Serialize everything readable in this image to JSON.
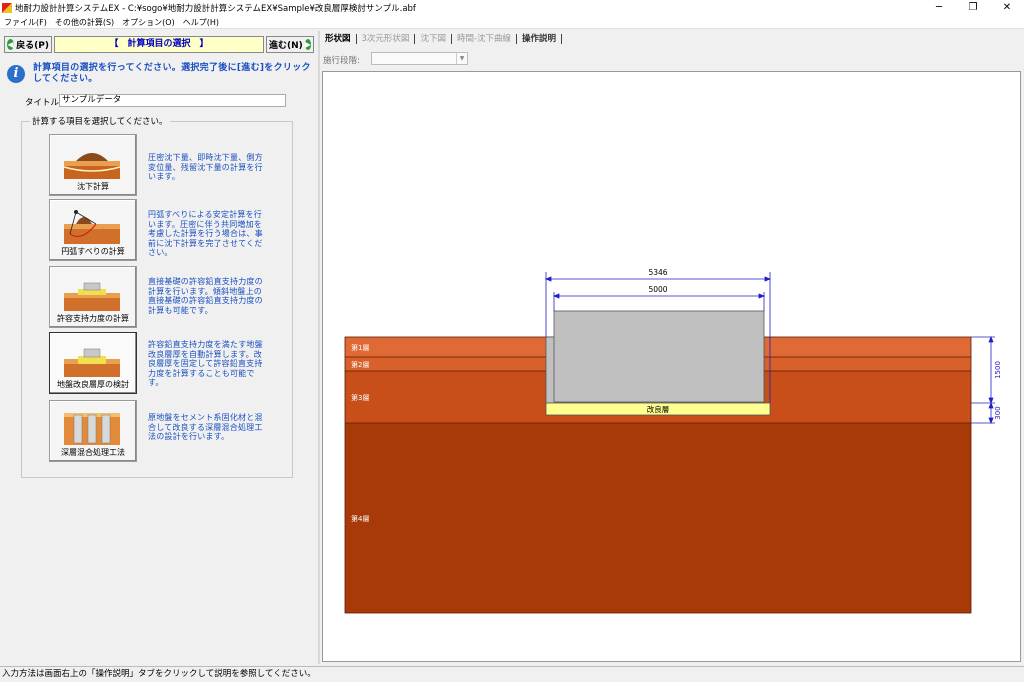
{
  "window": {
    "title": "地耐力設計計算システムEX - C:¥sogo¥地耐力設計計算システムEX¥Sample¥改良層厚検討サンプル.abf",
    "minimize": "─",
    "maximize": "❐",
    "close": "✕"
  },
  "menu": [
    "ファイル(F)",
    "その他の計算(S)",
    "オプション(O)",
    "ヘルプ(H)"
  ],
  "left": {
    "back_label": "戻る(P)",
    "step_title": "【　計算項目の選択　】",
    "next_label": "進む(N)",
    "instruction": "計算項目の選択を行ってください。選択完了後に[進む]をクリックしてください。",
    "title_label": "タイトル:",
    "title_value": "サンプルデータ",
    "group_label": "計算する項目を選択してください。",
    "items": [
      {
        "label": "沈下計算",
        "desc": "圧密沈下量、即時沈下量、側方変位量、残留沈下量の計算を行います。"
      },
      {
        "label": "円弧すべりの計算",
        "desc": "円弧すべりによる安定計算を行います。圧密に伴う共同増加を考慮した計算を行う場合は、事前に沈下計算を完了させてください。"
      },
      {
        "label": "許容支持力度の計算",
        "desc": "直接基礎の許容鉛直支持力度の計算を行います。傾斜地盤上の直接基礎の許容鉛直支持力度の計算も可能です。"
      },
      {
        "label": "地盤改良層厚の検討",
        "desc": "許容鉛直支持力度を満たす地盤改良層厚を自動計算します。改良層厚を固定して許容鉛直支持力度を計算することも可能です。"
      },
      {
        "label": "深層混合処理工法",
        "desc": "原地盤をセメント系固化材と混合して改良する深層混合処理工法の設計を行います。"
      }
    ]
  },
  "right": {
    "tabs": [
      "形状図",
      "3次元形状図",
      "沈下図",
      "時間-沈下曲線",
      "操作説明"
    ],
    "phase_label": "施行段階:",
    "drawing": {
      "dim_top": "5346",
      "dim_inner": "5000",
      "dim_right_upper": "1500",
      "dim_right_lower": "300",
      "improved_label": "改良層",
      "layers": [
        {
          "name": "第1層",
          "color": "#e06a35"
        },
        {
          "name": "第2層",
          "color": "#d8602a"
        },
        {
          "name": "第3層",
          "color": "#c84e1a"
        },
        {
          "name": "第4層",
          "color": "#a83a0a"
        }
      ],
      "structure_color": "#c0c0c0",
      "improved_color": "#ffff90",
      "dim_color": "#2020c0"
    }
  },
  "status": "入力方法は画面右上の「操作説明」タブをクリックして説明を参照してください。"
}
